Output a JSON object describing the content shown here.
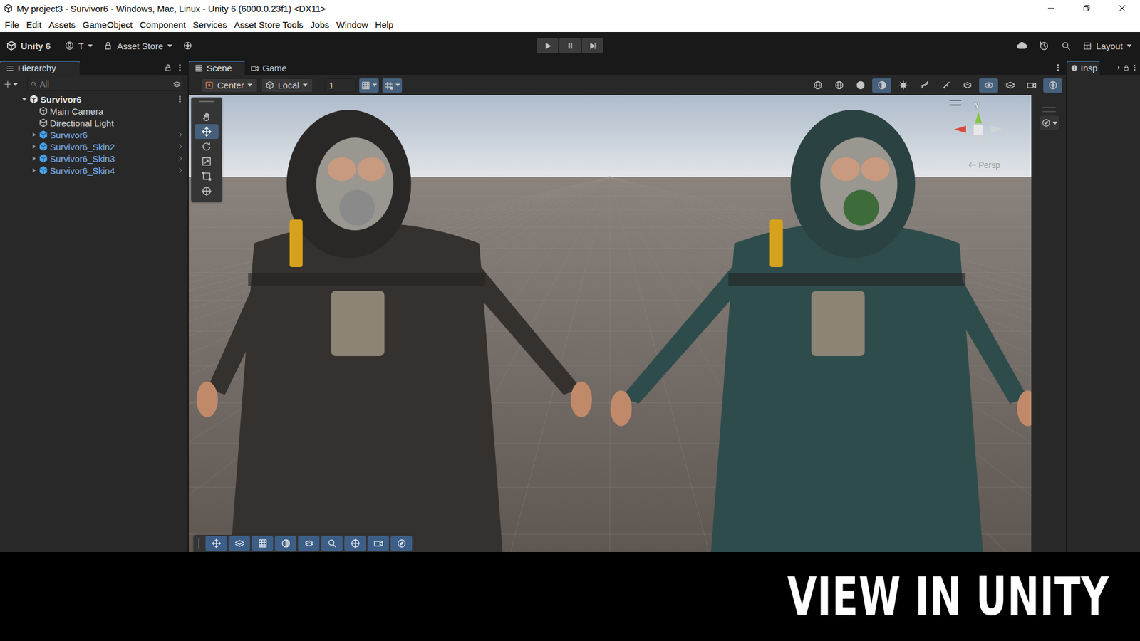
{
  "window": {
    "title": "My project3 - Survivor6 - Windows, Mac, Linux - Unity 6 (6000.0.23f1) <DX11>"
  },
  "menu": [
    "File",
    "Edit",
    "Assets",
    "GameObject",
    "Component",
    "Services",
    "Asset Store Tools",
    "Jobs",
    "Window",
    "Help"
  ],
  "toolbar": {
    "product": "Unity 6",
    "account": "T",
    "store": "Asset Store",
    "layout": "Layout",
    "playmode": [
      {
        "kind": "play",
        "selected": false
      },
      {
        "kind": "pause",
        "selected": false
      },
      {
        "kind": "step",
        "selected": false
      }
    ]
  },
  "hierarchy": {
    "tab": "Hierarchy",
    "search": {
      "placeholder": "All"
    },
    "items": [
      {
        "label": "Survivor6",
        "depth": 0,
        "kind": "scene",
        "expandable": true,
        "expanded": true
      },
      {
        "label": "Main Camera",
        "depth": 1,
        "kind": "object",
        "expandable": false,
        "expanded": false
      },
      {
        "label": "Directional Light",
        "depth": 1,
        "kind": "object",
        "expandable": false,
        "expanded": false
      },
      {
        "label": "Survivor6",
        "depth": 1,
        "kind": "prefab",
        "expandable": true,
        "expanded": false
      },
      {
        "label": "Survivor6_Skin2",
        "depth": 1,
        "kind": "prefab",
        "expandable": true,
        "expanded": false
      },
      {
        "label": "Survivor6_Skin3",
        "depth": 1,
        "kind": "prefab",
        "expandable": true,
        "expanded": false
      },
      {
        "label": "Survivor6_Skin4",
        "depth": 1,
        "kind": "prefab",
        "expandable": true,
        "expanded": false
      }
    ]
  },
  "scene": {
    "tabs": [
      {
        "label": "Scene",
        "selected": true
      },
      {
        "label": "Game",
        "selected": false
      }
    ],
    "pivot": "Center",
    "space": "Local",
    "grid_size": "1",
    "grid_buttons": [
      {
        "kind": "grid",
        "selected": true
      },
      {
        "kind": "snapgrid",
        "selected": true
      }
    ],
    "view_options": [
      {
        "kind": "globe",
        "selected": false
      },
      {
        "kind": "globe",
        "selected": false
      },
      {
        "kind": "sphere",
        "selected": false
      },
      {
        "kind": "shaded",
        "selected": true
      },
      {
        "kind": "fx",
        "selected": false
      },
      {
        "kind": "hidden",
        "selected": false
      },
      {
        "kind": "audio",
        "selected": false
      },
      {
        "kind": "snap",
        "selected": false
      },
      {
        "kind": "eye",
        "selected": true
      },
      {
        "kind": "layers",
        "selected": false
      },
      {
        "kind": "camera",
        "selected": false
      },
      {
        "kind": "gizmo",
        "selected": true
      }
    ],
    "tools": [
      {
        "kind": "hand",
        "selected": false
      },
      {
        "kind": "move",
        "selected": true
      },
      {
        "kind": "rotate",
        "selected": false
      },
      {
        "kind": "scale",
        "selected": false
      },
      {
        "kind": "rect",
        "selected": false
      },
      {
        "kind": "transform",
        "selected": false
      }
    ],
    "overlay_tools": [
      {
        "kind": "move",
        "selected": true
      },
      {
        "kind": "layers",
        "selected": true
      },
      {
        "kind": "grid",
        "selected": true
      },
      {
        "kind": "shaded",
        "selected": true
      },
      {
        "kind": "snap",
        "selected": true
      },
      {
        "kind": "search",
        "selected": true
      },
      {
        "kind": "transform",
        "selected": true
      },
      {
        "kind": "camera",
        "selected": true
      },
      {
        "kind": "compass",
        "selected": true
      }
    ],
    "gizmo": {
      "axis_label": "y",
      "projection": "Persp"
    }
  },
  "inspector": {
    "tab": "Insp"
  },
  "banner": "VIEW IN UNITY"
}
